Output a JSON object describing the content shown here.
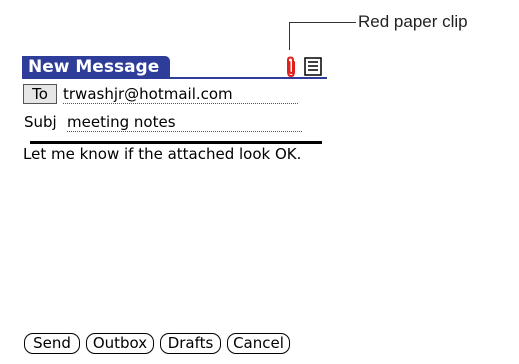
{
  "callout": {
    "label": "Red paper clip"
  },
  "window": {
    "title": "New Message"
  },
  "icons": {
    "attachment": "paperclip-icon",
    "details": "document-icon",
    "clip_color": "#e0201b",
    "title_color": "#2e3d99"
  },
  "to": {
    "button_label": "To",
    "value": "trwashjr@hotmail.com"
  },
  "subject": {
    "label": "Subj",
    "value": "meeting notes"
  },
  "message": {
    "body": "Let me know if the attached look OK."
  },
  "buttons": {
    "send": "Send",
    "outbox": "Outbox",
    "drafts": "Drafts",
    "cancel": "Cancel"
  }
}
